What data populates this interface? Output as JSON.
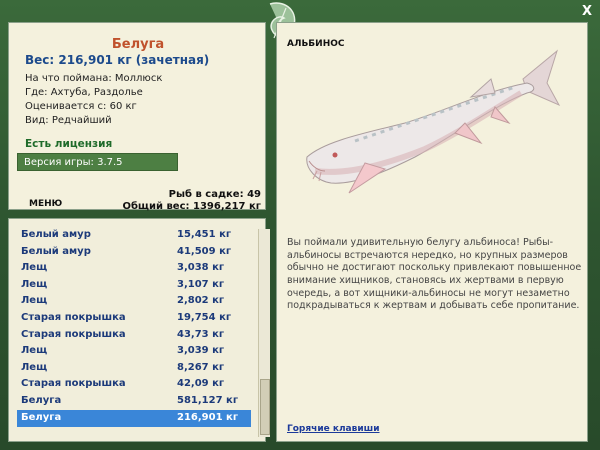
{
  "fish": {
    "name": "Белуга",
    "weight": "Вес: 216,901 кг (зачетная)",
    "bait": "На что поймана: Моллюск",
    "location": "Где: Ахтуба, Раздолье",
    "valued_from": "Оценивается с: 60 кг",
    "kind": "Вид: Редчайший"
  },
  "license": "Есть лицензия",
  "version": "Версия игры: 3.7.5",
  "menu_label": "МЕНЮ",
  "stats": {
    "count": "Рыб в садке: 49",
    "total": "Общий вес: 1396,217 кг"
  },
  "catch_list": [
    {
      "name": "Белый амур",
      "weight": "15,451 кг"
    },
    {
      "name": "Белый амур",
      "weight": "41,509 кг"
    },
    {
      "name": "Лещ",
      "weight": "3,038 кг"
    },
    {
      "name": "Лещ",
      "weight": "3,107 кг"
    },
    {
      "name": "Лещ",
      "weight": "2,802 кг"
    },
    {
      "name": "Старая покрышка",
      "weight": "19,754 кг"
    },
    {
      "name": "Старая покрышка",
      "weight": "43,73 кг"
    },
    {
      "name": "Лещ",
      "weight": "3,039 кг"
    },
    {
      "name": "Лещ",
      "weight": "8,267 кг"
    },
    {
      "name": "Старая покрышка",
      "weight": "42,09 кг"
    },
    {
      "name": "Белуга",
      "weight": "581,127 кг"
    },
    {
      "name": "Белуга",
      "weight": "216,901 кг"
    }
  ],
  "albino_label": "АЛЬБИНОС",
  "description": "Вы поймали удивительную белугу альбиноса! Рыбы-альбиносы встречаются нередко, но крупных размеров обычно не достигают поскольку привлекают повышенное внимание хищников, становясь их жертвами в первую очередь, а вот хищники-альбиносы не могут незаметно подкрадываться к жертвам и добывать себе пропитание.",
  "hotkeys": "Горячие клавиши",
  "close_label": "X",
  "colors": {
    "frame": "#2e5530",
    "panel": "#f4f1dd",
    "title": "#c0522c",
    "accent_blue": "#1c4a8c",
    "selected_row": "#3a86d8",
    "version_bar": "#4d7f43"
  }
}
